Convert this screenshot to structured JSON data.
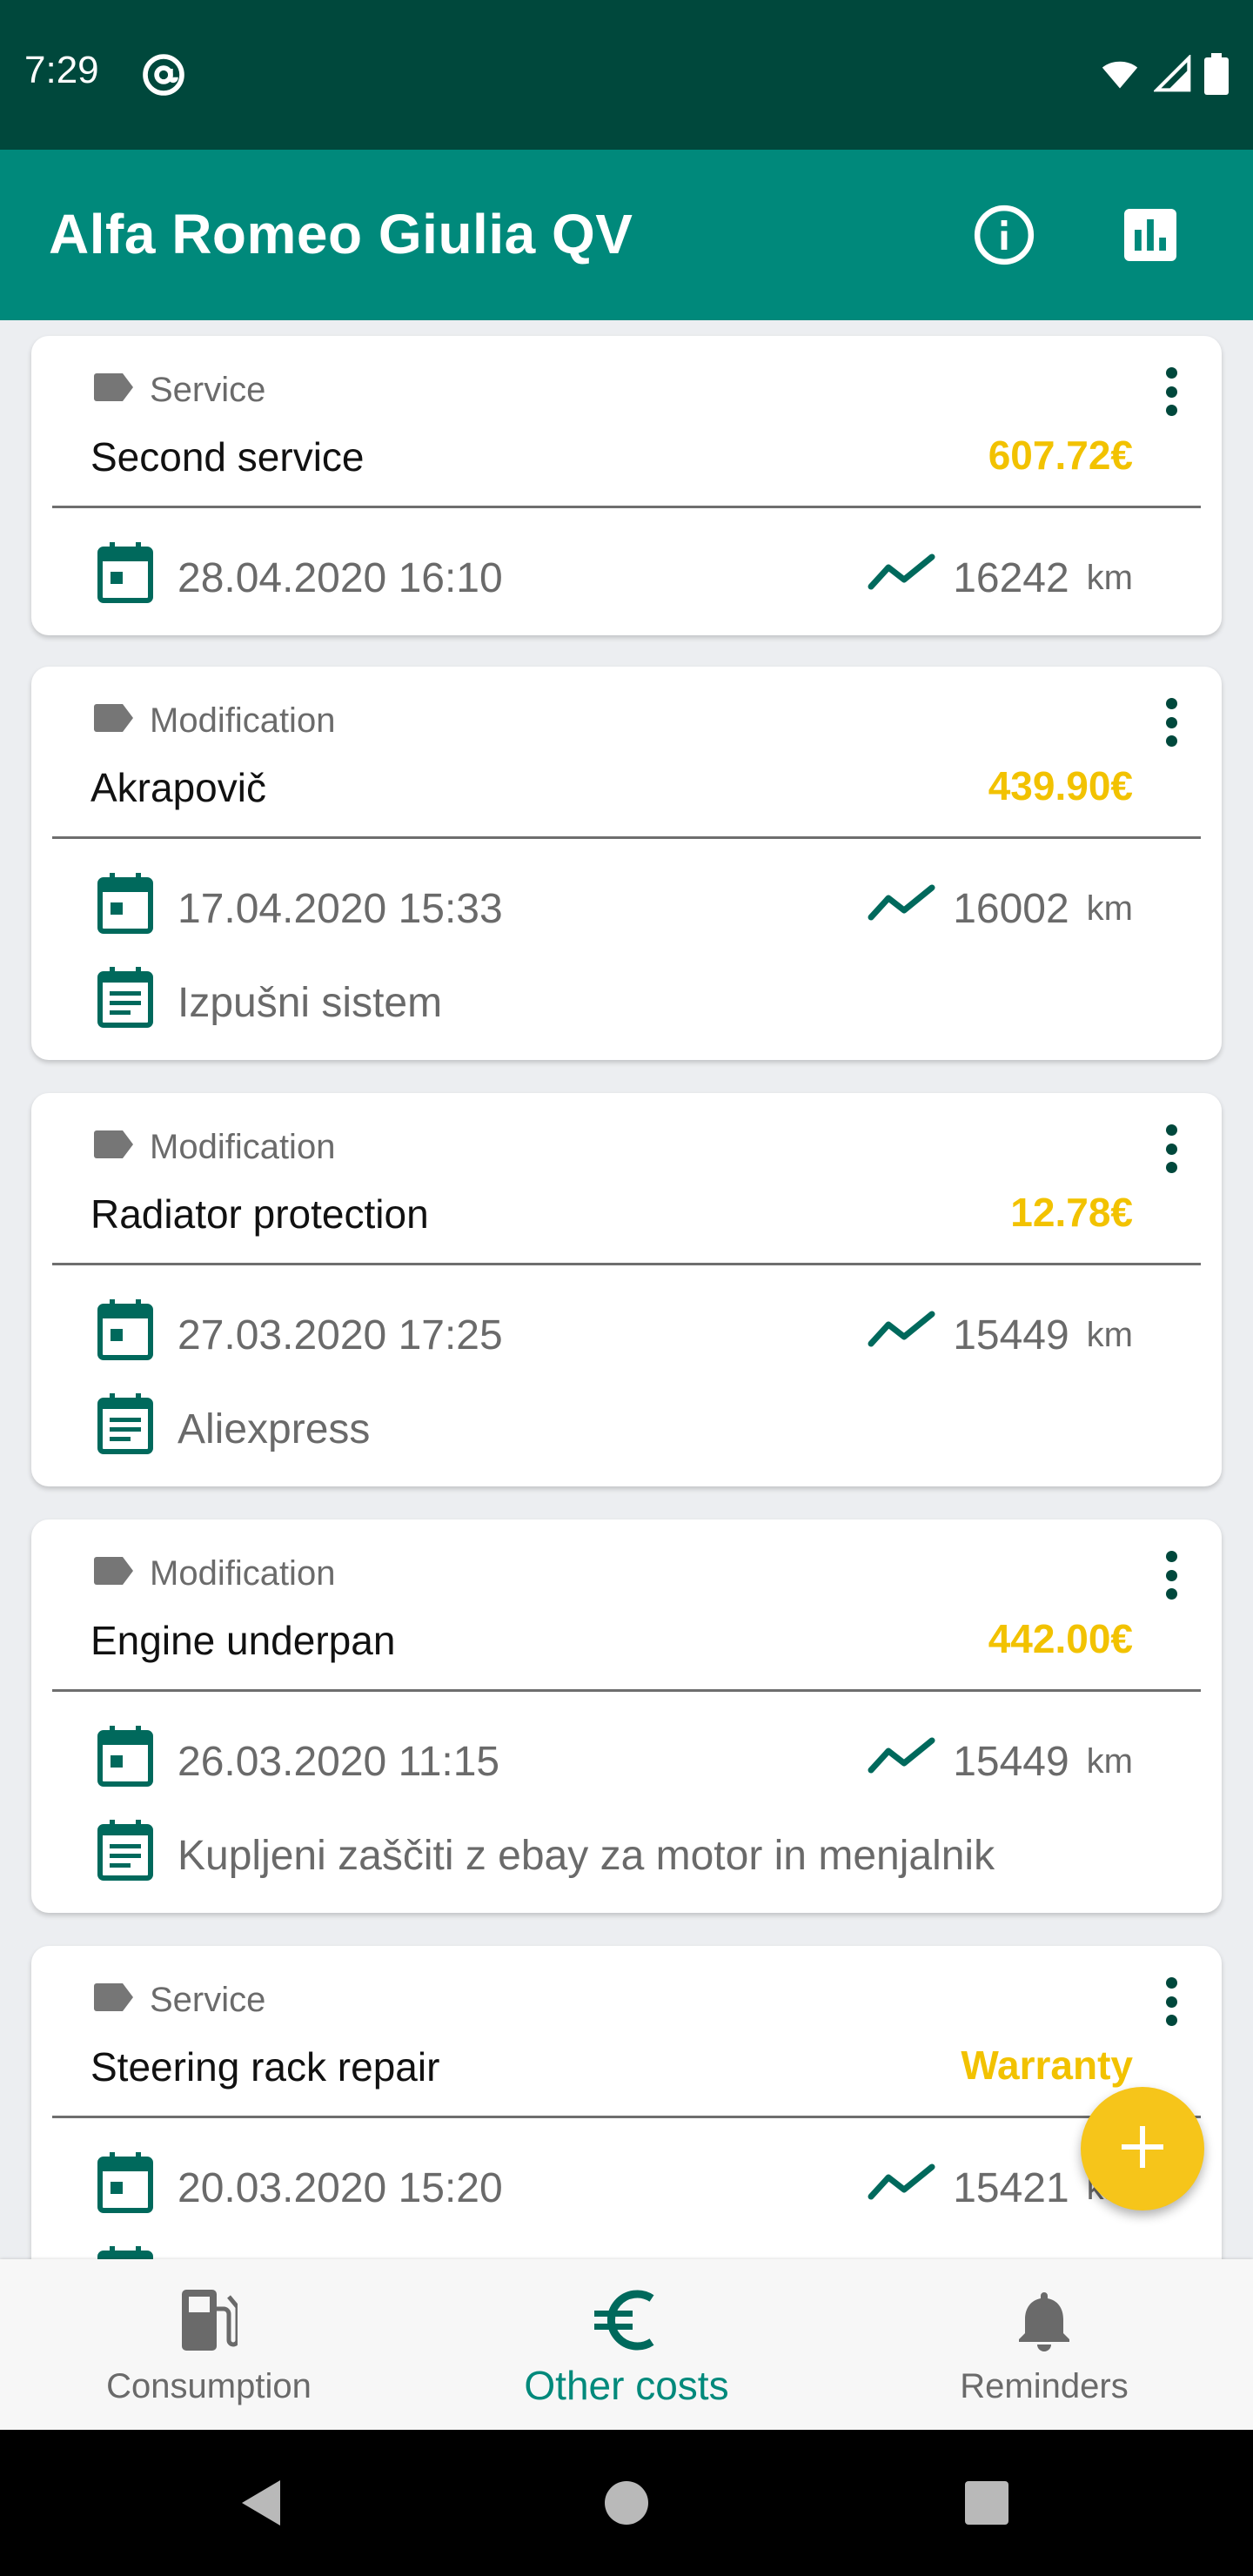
{
  "status_bar": {
    "time": "7:29"
  },
  "app_bar": {
    "title": "Alfa Romeo Giulia QV"
  },
  "entries": [
    {
      "category": "Service",
      "name": "Second service",
      "price": "607.72€",
      "datetime": "28.04.2020 16:10",
      "odometer": "16242",
      "unit": "km",
      "note": ""
    },
    {
      "category": "Modification",
      "name": "Akrapovič",
      "price": "439.90€",
      "datetime": "17.04.2020 15:33",
      "odometer": "16002",
      "unit": "km",
      "note": "Izpušni sistem"
    },
    {
      "category": "Modification",
      "name": "Radiator protection",
      "price": "12.78€",
      "datetime": "27.03.2020 17:25",
      "odometer": "15449",
      "unit": "km",
      "note": "Aliexpress"
    },
    {
      "category": "Modification",
      "name": "Engine underpan",
      "price": "442.00€",
      "datetime": "26.03.2020 11:15",
      "odometer": "15449",
      "unit": "km",
      "note": "Kupljeni zaščiti z ebay za motor in menjalnik"
    },
    {
      "category": "Service",
      "name": "Steering rack repair",
      "price": "Warranty",
      "datetime": "20.03.2020 15:20",
      "odometer": "15421",
      "unit": "km",
      "note": ""
    }
  ],
  "bottom_nav": {
    "items": [
      {
        "label": "Consumption",
        "icon": "fuel-pump-icon"
      },
      {
        "label": "Other costs",
        "icon": "euro-icon",
        "active": true
      },
      {
        "label": "Reminders",
        "icon": "bell-icon"
      }
    ]
  },
  "colors": {
    "primary": "#00897b",
    "primary_dark": "#00483c",
    "accent": "#f6c51a",
    "price": "#f2c200"
  }
}
